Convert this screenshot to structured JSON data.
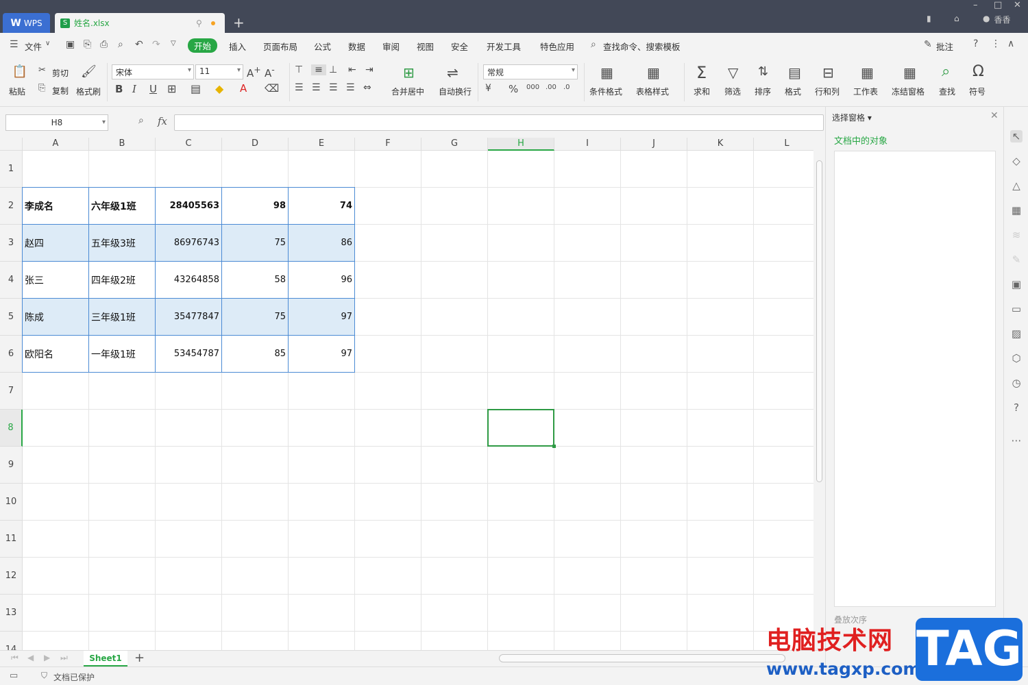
{
  "titlebar": {
    "home_tab": "WPS",
    "file_tab": "姓名.xlsx",
    "login": "香香"
  },
  "menu": {
    "items": [
      "文件",
      "开始",
      "插入",
      "页面布局",
      "公式",
      "数据",
      "审阅",
      "视图",
      "安全",
      "开发工具",
      "特色应用"
    ],
    "active": "开始",
    "search": "查找命令、搜索模板",
    "comment": "批注"
  },
  "ribbon": {
    "paste": "粘贴",
    "cut": "剪切",
    "copy": "复制",
    "format_painter": "格式刷",
    "font": "宋体",
    "font_size": "11",
    "merge": "合并居中",
    "wrap": "自动换行",
    "number_format": "常规",
    "cond_format": "条件格式",
    "table_style": "表格样式",
    "sum": "求和",
    "filter": "筛选",
    "sort": "排序",
    "format": "格式",
    "rowcol": "行和列",
    "sheet": "工作表",
    "freeze": "冻结窗格",
    "find": "查找",
    "symbol": "符号"
  },
  "formula": {
    "cell_ref": "H8",
    "fx": "fx",
    "value": ""
  },
  "grid": {
    "columns": [
      "A",
      "B",
      "C",
      "D",
      "E",
      "F",
      "G",
      "H",
      "I",
      "J",
      "K",
      "L"
    ],
    "rows": [
      "1",
      "2",
      "3",
      "4",
      "5",
      "6",
      "7",
      "8",
      "9",
      "10",
      "11",
      "12",
      "13",
      "14"
    ],
    "selected_col": "H",
    "selected_row": "8",
    "data": [
      [
        "李成名",
        "六年级1班",
        "28405563",
        "98",
        "74"
      ],
      [
        "赵四",
        "五年级3班",
        "86976743",
        "75",
        "86"
      ],
      [
        "张三",
        "四年级2班",
        "43264858",
        "58",
        "96"
      ],
      [
        "陈成",
        "三年级1班",
        "35477847",
        "75",
        "97"
      ],
      [
        "欧阳名",
        "一年级1班",
        "53454787",
        "85",
        "97"
      ]
    ]
  },
  "sheets": {
    "active": "Sheet1"
  },
  "status": {
    "protect": "文档已保护"
  },
  "side_panel": {
    "title": "选择窗格",
    "subtitle": "文档中的对象",
    "order": "叠放次序"
  },
  "watermark": {
    "site_cn": "电脑技术网",
    "url": "www.tagxp.com",
    "tag": "TAG"
  }
}
